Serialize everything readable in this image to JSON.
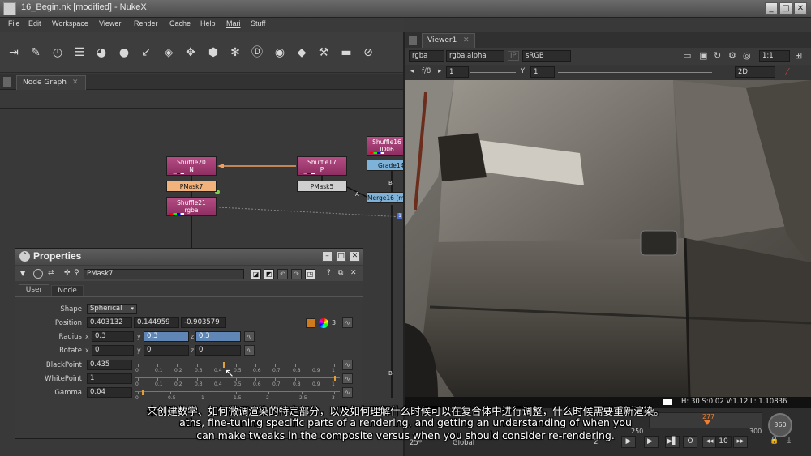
{
  "window": {
    "title": "16_Begin.nk [modified] - NukeX"
  },
  "menu": [
    "File",
    "Edit",
    "Workspace",
    "Viewer",
    "Render",
    "Cache",
    "Help",
    "Mari",
    "Stuff"
  ],
  "toolbar_icons": [
    "transform-icon",
    "paint-brush-icon",
    "time-icon",
    "channel-icon",
    "color-wheel-icon",
    "filter-sphere-icon",
    "keyer-icon",
    "merge-layers-icon",
    "transform-move-icon",
    "3d-cube-icon",
    "particles-icon",
    "deep-icon",
    "views-icon",
    "metadata-icon",
    "toolsets-icon",
    "other-icon",
    "furnace-icon"
  ],
  "node_graph": {
    "tab_label": "Node Graph",
    "nodes": {
      "shuffle20": {
        "name": "Shuffle20",
        "sub": "N"
      },
      "pmask7": {
        "name": "PMask7"
      },
      "shuffle21": {
        "name": "Shuffle21",
        "sub": "rgba"
      },
      "shuffle17": {
        "name": "Shuffle17",
        "sub": "P"
      },
      "pmask5": {
        "name": "PMask5"
      },
      "shuffle16": {
        "name": "Shuffle16",
        "sub": "ID06"
      },
      "grade14": {
        "name": "Grade14"
      },
      "merge16": {
        "name": "Merge16 (m"
      }
    },
    "pipe_labels": {
      "a": "A",
      "b": "B"
    }
  },
  "properties": {
    "title": "Properties",
    "node_name": "PMask7",
    "tabs": [
      "User",
      "Node"
    ],
    "shape": {
      "label": "Shape",
      "value": "Spherical"
    },
    "position": {
      "label": "Position",
      "x": "0.403132",
      "y": "0.144959",
      "z": "-0.903579",
      "count": "3"
    },
    "radius": {
      "label": "Radius",
      "x": "0.3",
      "y": "0.3",
      "z": "0.3"
    },
    "rotate": {
      "label": "Rotate",
      "x": "0",
      "y": "0",
      "z": "0"
    },
    "blackpoint": {
      "label": "BlackPoint",
      "value": "0.435",
      "level": 0.435
    },
    "whitepoint": {
      "label": "WhitePoint",
      "value": "1",
      "level": 1
    },
    "gamma": {
      "label": "Gamma",
      "value": "0.04",
      "level": 0.02
    },
    "slider_ticks": [
      "0",
      "0.1",
      "0.2",
      "0.3",
      "0.4",
      "0.5",
      "0.6",
      "0.7",
      "0.8",
      "0.9",
      "1"
    ],
    "gamma_ticks": [
      "0",
      "0.5",
      "1",
      "1.5",
      "2",
      "2.5",
      "3"
    ],
    "axis": {
      "x": "x",
      "y": "y",
      "z": "z"
    }
  },
  "viewer": {
    "tab_label": "Viewer1",
    "channels": "rgba",
    "channel_alpha": "rgba.alpha",
    "ip": "IP",
    "colorspace": "sRGB",
    "scale": "1:1",
    "fstop": "f/8",
    "gain": "1",
    "gamma_label": "Y",
    "gamma": "1",
    "view_mode": "2D",
    "status_right": "H: 30 S:0.02 V:1.12  L: 1.10836"
  },
  "timeline": {
    "frame_current": "277",
    "frame_marks": [
      "250",
      "300"
    ],
    "fps": "25*",
    "global_label": "Global",
    "increment": "10",
    "frame_field": "2",
    "time_display": "360"
  },
  "subtitles": {
    "chinese": "来创建数学、如何微调渲染的特定部分，以及如何理解什么时候可以在复合体中进行调整，什么时候需要重新渲染。",
    "line1": "aths, fine-tuning specific parts of a rendering, and getting an understanding of when you",
    "line2": "can make tweaks in the composite versus when you should consider re-rendering."
  },
  "colors": {
    "pink_node": "#a23b74",
    "peach_node": "#f2b27b",
    "selection_blue": "#5f86b4"
  }
}
